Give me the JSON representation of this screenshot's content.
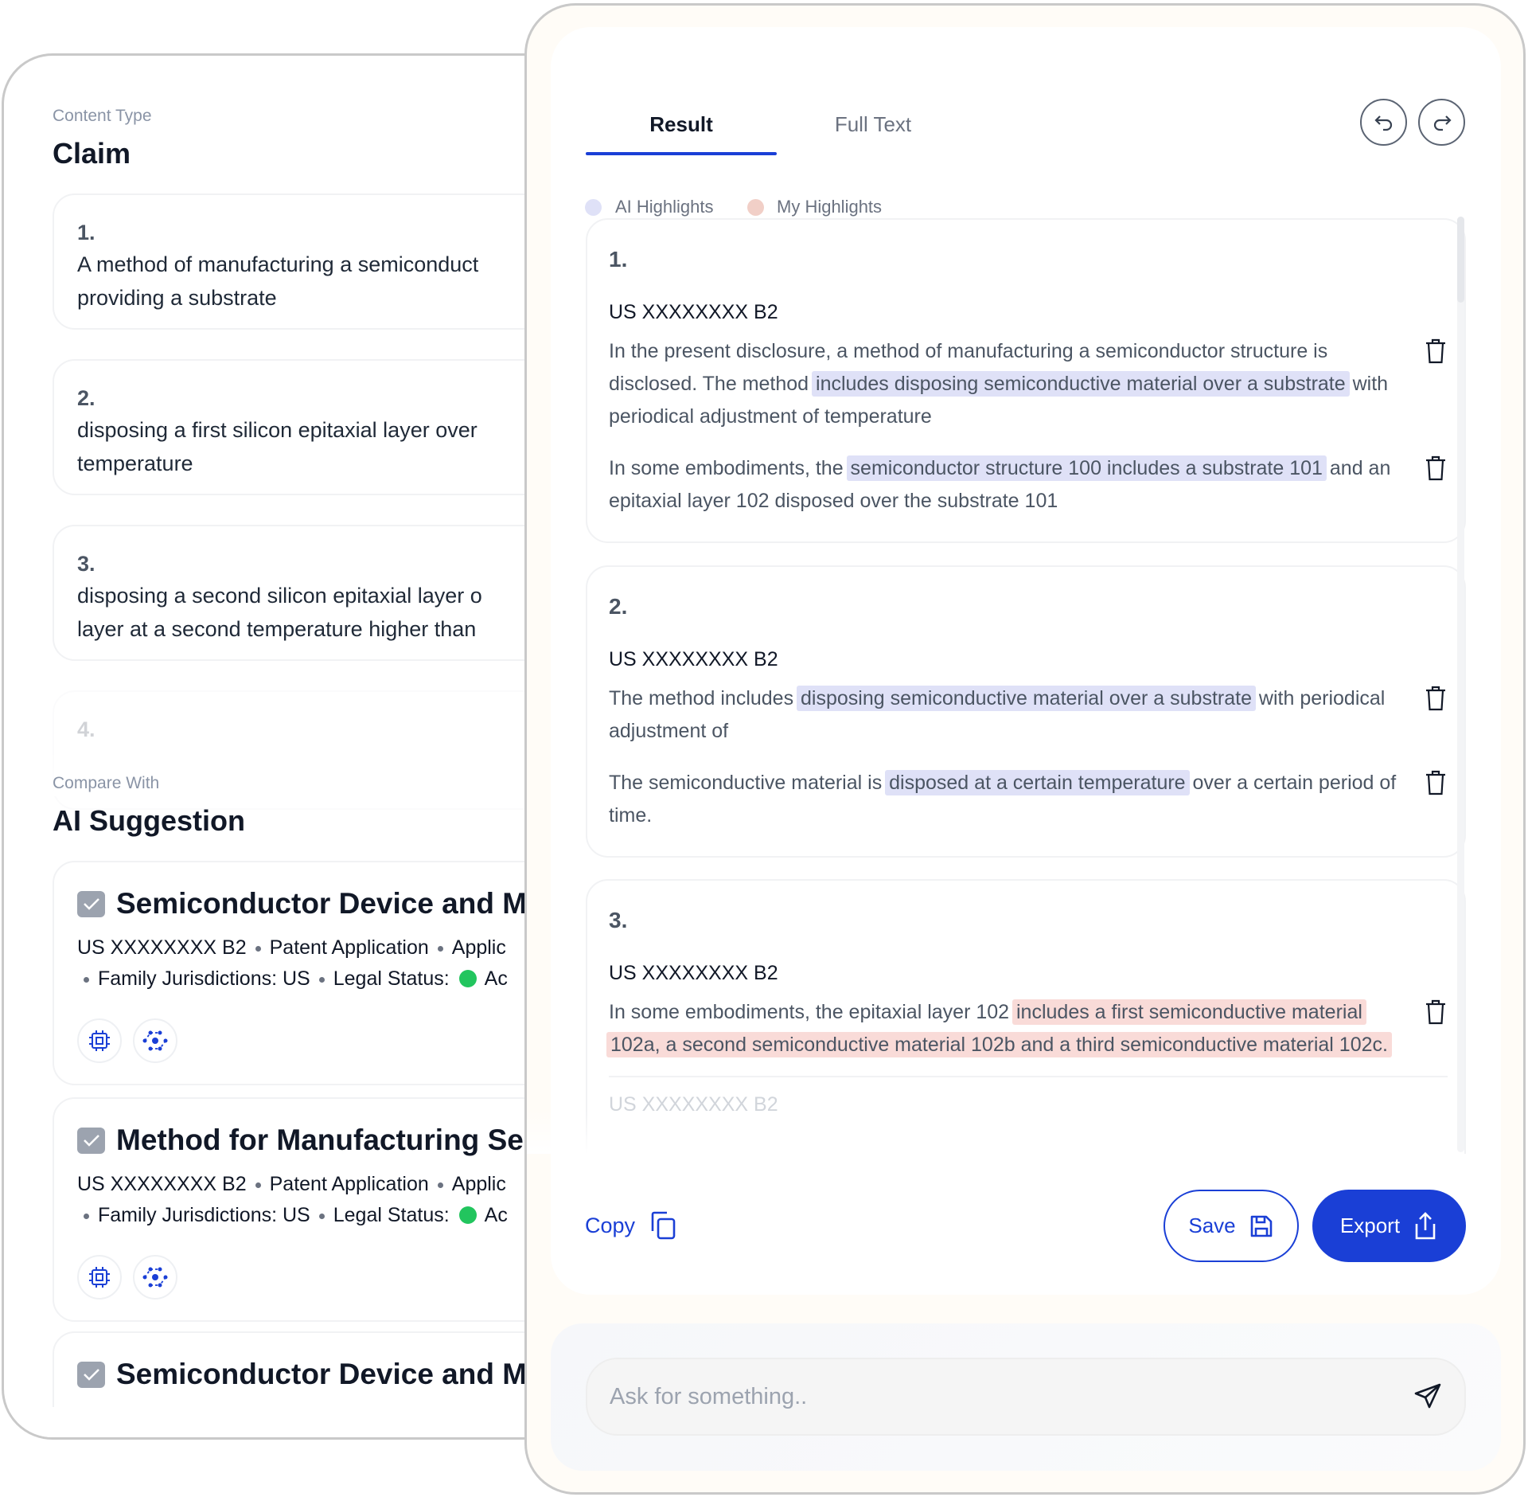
{
  "left_panel": {
    "content_type_label": "Content Type",
    "content_type_value": "Claim",
    "claims": [
      {
        "number": "1.",
        "lines": [
          "A method of manufacturing a semiconduct",
          "providing a substrate"
        ]
      },
      {
        "number": "2.",
        "lines": [
          "disposing a first silicon epitaxial layer over",
          "temperature"
        ]
      },
      {
        "number": "3.",
        "lines": [
          "disposing a second silicon epitaxial layer o",
          "layer at a second temperature higher than"
        ]
      },
      {
        "number": "4."
      }
    ],
    "compare_label": "Compare With",
    "compare_value": "AI Suggestion",
    "suggestions": [
      {
        "title": "Semiconductor Device and Ma",
        "checked": true,
        "patent_id": "US XXXXXXXX B2",
        "type": "Patent Application",
        "applicant": "Applic",
        "jurisdictions": "Family Jurisdictions: US",
        "legal_status_label": "Legal Status:",
        "legal_status": "Ac",
        "icons": [
          "chip-icon",
          "network-icon"
        ]
      },
      {
        "title": "Method for Manufacturing Se",
        "checked": true,
        "patent_id": "US XXXXXXXX B2",
        "type": "Patent Application",
        "applicant": "Applic",
        "jurisdictions": "Family Jurisdictions: US",
        "legal_status_label": "Legal Status:",
        "legal_status": "Ac",
        "icons": [
          "chip-icon",
          "network-icon"
        ]
      },
      {
        "title": "Semiconductor Device and Ma",
        "checked": true
      }
    ],
    "status_color": "#22c55e"
  },
  "right_panel": {
    "tabs": [
      {
        "label": "Result",
        "active": true
      },
      {
        "label": "Full Text",
        "active": false
      }
    ],
    "legend": {
      "ai": "AI Highlights",
      "mine": "My Highlights",
      "ai_color": "#dfe1f7",
      "mine_color": "#f9dbd8"
    },
    "results": [
      {
        "number": "1.",
        "patent_id": "US XXXXXXXX B2",
        "paragraphs": [
          {
            "pre": "In the present disclosure, a method of manufacturing a semiconductor structure is disclosed. The method ",
            "hl": "includes disposing semiconductive material over a substrate",
            "post": " with periodical adjustment of temperature",
            "kind": "ai"
          },
          {
            "pre": "In some embodiments, the ",
            "hl": "semiconductor structure 100 includes a substrate 101",
            "post": " and an epitaxial layer 102 disposed over the substrate 101",
            "kind": "ai"
          }
        ]
      },
      {
        "number": "2.",
        "patent_id": "US XXXXXXXX B2",
        "paragraphs": [
          {
            "pre": "The method includes ",
            "hl": "disposing semiconductive material over a substrate",
            "post": " with periodical adjustment of",
            "kind": "ai"
          },
          {
            "pre": "The semiconductive material is ",
            "hl": "disposed at a certain temperature",
            "post": " over a certain period of time.",
            "kind": "ai"
          }
        ]
      },
      {
        "number": "3.",
        "patent_id": "US XXXXXXXX B2",
        "paragraphs": [
          {
            "pre": "In some embodiments, the epitaxial layer 102 ",
            "hl": "includes a first semiconductive material 102a, a second semiconductive material 102b and a third semiconductive material 102c.",
            "post": "",
            "kind": "mine"
          }
        ],
        "next_patent_id": "US XXXXXXXX B2"
      }
    ],
    "copy_label": "Copy",
    "save_label": "Save",
    "export_label": "Export",
    "ask_placeholder": "Ask for something..",
    "accent_color": "#1a3fd6"
  }
}
